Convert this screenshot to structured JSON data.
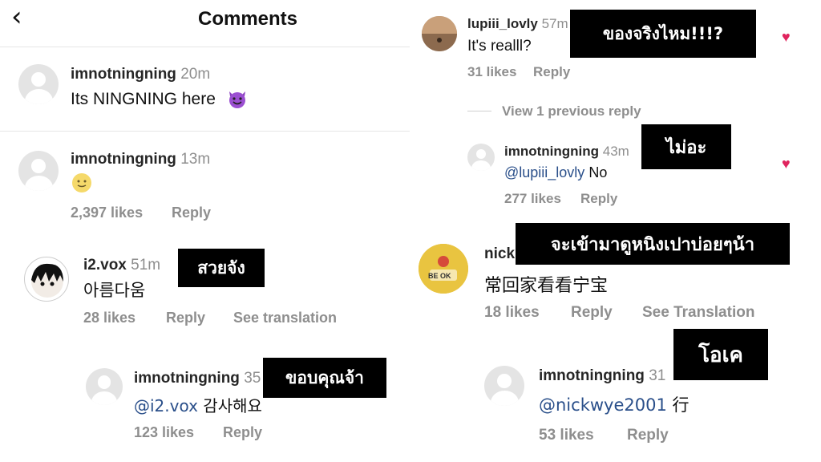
{
  "header": {
    "title": "Comments",
    "back_icon": "chevron-left-icon"
  },
  "left": {
    "c1": {
      "username": "imnotningning",
      "time": "20m",
      "text": "Its NINGNING here"
    },
    "c2": {
      "username": "imnotningning",
      "time": "13m",
      "likes": "2,397 likes",
      "reply": "Reply"
    },
    "c3": {
      "username": "i2.vox",
      "time": "51m",
      "text": "아름다움",
      "likes": "28 likes",
      "reply": "Reply",
      "translate": "See translation",
      "overlay": "สวยจัง"
    },
    "c4": {
      "username": "imnotningning",
      "time": "35",
      "mention": "@i2.vox",
      "text": "감사해요",
      "likes": "123 likes",
      "reply": "Reply",
      "overlay": "ขอบคุณจ้า"
    }
  },
  "right": {
    "c1": {
      "username": "lupiii_lovly",
      "time": "57m",
      "text": "It's realll?",
      "likes": "31 likes",
      "reply": "Reply",
      "overlay": "ของจริงไหม!!!?"
    },
    "view_previous": "View 1 previous reply",
    "c2": {
      "username": "imnotningning",
      "time": "43m",
      "mention": "@lupiii_lovly",
      "text": "No",
      "likes": "277 likes",
      "reply": "Reply",
      "overlay": "ไม่อะ"
    },
    "c3": {
      "username_visible": "nick",
      "text": "常回家看看宁宝",
      "likes": "18 likes",
      "reply": "Reply",
      "translate": "See Translation",
      "overlay": "จะเข้ามาดูหนิงเปาบ่อยๆน้า",
      "avatar_text": "BE OK"
    },
    "c4": {
      "username": "imnotningning",
      "time": "31",
      "mention": "@nickwye2001",
      "text": "行",
      "likes": "53 likes",
      "reply": "Reply",
      "overlay": "โอเค"
    }
  },
  "colors": {
    "heart": "#e0245e",
    "mention": "#2a4f8a",
    "overlay_bg": "#000000"
  }
}
